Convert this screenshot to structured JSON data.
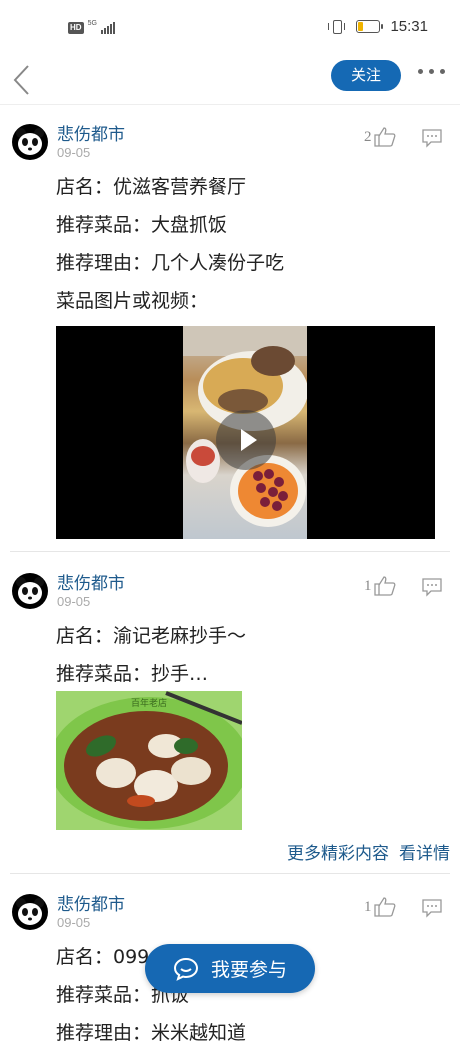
{
  "status_bar": {
    "hd_badge": "HD",
    "network": "5G",
    "time": "15:31",
    "battery_level": 0.2
  },
  "nav": {
    "back_icon": "chevron-left-icon",
    "follow_label": "关注",
    "more_icon": "more-dots-icon"
  },
  "posts": [
    {
      "username": "悲伤都市",
      "date": "09-05",
      "likes": "2",
      "lines": [
        "店名：优滋客营养餐厅",
        "推荐菜品：大盘抓饭",
        "推荐理由：几个人凑份子吃",
        "菜品图片或视频："
      ]
    },
    {
      "username": "悲伤都市",
      "date": "09-05",
      "likes": "1",
      "lines": [
        "店名：渝记老麻抄手～",
        "推荐菜品：抄手…"
      ],
      "photo_caption_mark": "百年老店"
    },
    {
      "username": "悲伤都市",
      "date": "09-05",
      "likes": "1",
      "lines": [
        "店名：099",
        "推荐菜品：抓饭",
        "推荐理由：米米越知道"
      ]
    }
  ],
  "more_content_label": "更多精彩内容",
  "details_label": "看详情",
  "join_button_label": "我要参与",
  "colors": {
    "accent": "#1569b4",
    "username": "#1e5a8c"
  }
}
